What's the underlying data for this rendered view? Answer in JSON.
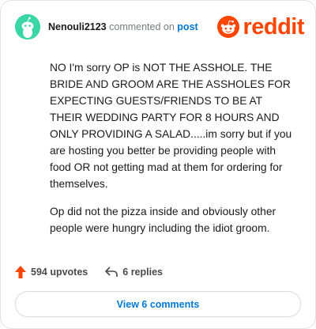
{
  "comment": {
    "username": "Nenouli2123",
    "action_text": "commented on",
    "post_link": "post",
    "paragraphs": [
      "NO I'm sorry OP is NOT THE ASSHOLE. THE BRIDE AND GROOM ARE THE ASSHOLES FOR EXPECTING GUESTS/FRIENDS TO BE AT THEIR WEDDING PARTY FOR 8 HOURS AND ONLY PROVIDING A SALAD.....im sorry but if you are hosting you better be providing people with food OR not getting mad at them for ordering for themselves.",
      "Op did not the pizza inside and obviously other people were hungry including the idiot groom."
    ]
  },
  "brand": {
    "wordmark": "reddit",
    "color": "#ff4500"
  },
  "stats": {
    "upvotes": "594 upvotes",
    "replies": "6 replies"
  },
  "actions": {
    "view_comments": "View 6 comments"
  },
  "colors": {
    "avatar": "#3ad6a4",
    "link": "#0079d3",
    "upvote_arrow": "#ff4500"
  },
  "icons": [
    "snoo-avatar-icon",
    "reddit-logo-icon",
    "upvote-arrow-icon",
    "reply-arrow-icon"
  ]
}
